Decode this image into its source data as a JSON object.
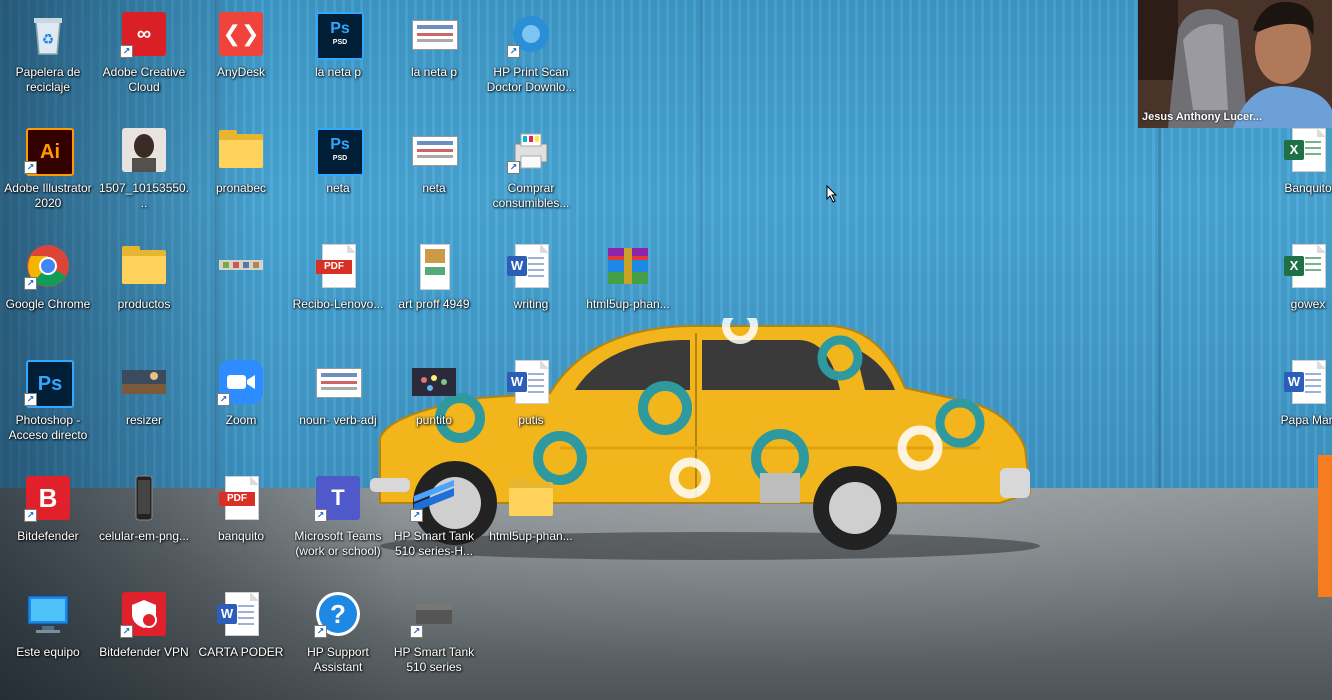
{
  "desktop": {
    "icons": [
      {
        "label": "Papelera de reciclaje",
        "kind": "recycle"
      },
      {
        "label": "Adobe Creative Cloud",
        "kind": "adobecc"
      },
      {
        "label": "AnyDesk",
        "kind": "anydesk"
      },
      {
        "label": "la neta p",
        "kind": "psd"
      },
      {
        "label": "la neta p",
        "kind": "thumb"
      },
      {
        "label": "HP Print Scan Doctor Downlo...",
        "kind": "hp-scan"
      },
      {
        "label": "Adobe Illustrator 2020",
        "kind": "ai"
      },
      {
        "label": "1507_10153550...",
        "kind": "photo"
      },
      {
        "label": "pronabec",
        "kind": "folder"
      },
      {
        "label": "neta",
        "kind": "psd"
      },
      {
        "label": "neta",
        "kind": "thumb"
      },
      {
        "label": "Comprar consumibles...",
        "kind": "printer"
      },
      {
        "label": "Google Chrome",
        "kind": "chrome"
      },
      {
        "label": "productos",
        "kind": "folder"
      },
      {
        "label": "",
        "kind": "strip"
      },
      {
        "label": "Recibo-Lenovo...",
        "kind": "pdf"
      },
      {
        "label": "art proff 4949",
        "kind": "doc-image"
      },
      {
        "label": "writing",
        "kind": "word"
      },
      {
        "label": "html5up-phan...",
        "kind": "winrar"
      },
      {
        "label": "Photoshop - Acceso directo",
        "kind": "ps"
      },
      {
        "label": "resizer",
        "kind": "photo-landscape"
      },
      {
        "label": "Zoom",
        "kind": "zoom"
      },
      {
        "label": "noun- verb-adj",
        "kind": "thumb"
      },
      {
        "label": "puntito",
        "kind": "photo-dark"
      },
      {
        "label": "putis",
        "kind": "word"
      },
      {
        "label": "Bitdefender",
        "kind": "bitdefender"
      },
      {
        "label": "celular-em-png...",
        "kind": "phone"
      },
      {
        "label": "banquito",
        "kind": "pdf"
      },
      {
        "label": "Microsoft Teams (work or school)",
        "kind": "teams"
      },
      {
        "label": "HP Smart Tank 510 series-H...",
        "kind": "hp-tank"
      },
      {
        "label": "html5up-phan...",
        "kind": "folder"
      },
      {
        "label": "Este equipo",
        "kind": "computer"
      },
      {
        "label": "Bitdefender VPN",
        "kind": "bdvpn"
      },
      {
        "label": "CARTA PODER",
        "kind": "word"
      },
      {
        "label": "HP Support Assistant",
        "kind": "hp-support"
      },
      {
        "label": "HP Smart Tank 510 series",
        "kind": "printer-dark"
      },
      {
        "label": "Banquito",
        "kind": "excel"
      },
      {
        "label": "gowex",
        "kind": "excel"
      },
      {
        "label": "Papa Mari",
        "kind": "word"
      }
    ]
  },
  "webcam": {
    "participant_name": "Jesus Anthony Lucer..."
  },
  "colors": {
    "wall_blue": "#4aa7d6",
    "car_yellow": "#f2b51c",
    "car_ring_teal": "#2e9aa0",
    "accent_orange": "#f57c1f"
  }
}
